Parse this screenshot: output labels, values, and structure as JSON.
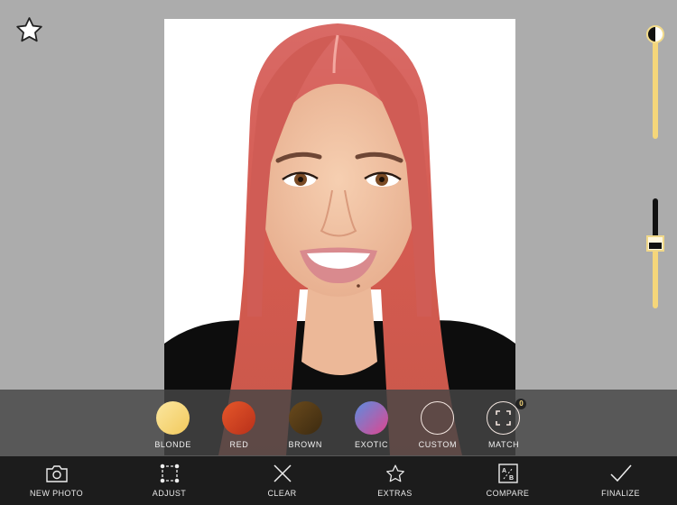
{
  "top": {
    "favorite_icon": "star-outline-icon"
  },
  "photo": {
    "description": "Portrait of smiling woman with hair recolored red",
    "hair_color": "#d9605c",
    "skin_color": "#f1c4a6",
    "shirt_color": "#0d0d0d"
  },
  "sliders": {
    "brightness": {
      "icon": "half-moon-contrast-icon",
      "value_fraction": 0.0
    },
    "intensity": {
      "value_fraction": 0.62
    }
  },
  "color_palette": {
    "swatches": [
      {
        "label": "BLONDE",
        "gradient": [
          "#fbe7a0",
          "#f2c95c"
        ]
      },
      {
        "label": "RED",
        "gradient": [
          "#e6572a",
          "#b8301a"
        ]
      },
      {
        "label": "BROWN",
        "gradient": [
          "#6a4a1c",
          "#3c2a10"
        ]
      },
      {
        "label": "EXOTIC",
        "gradient": [
          "#5b8ee0",
          "#e0458f"
        ]
      },
      {
        "label": "CUSTOM",
        "gradient": null
      },
      {
        "label": "MATCH",
        "gradient": null,
        "badge": "0"
      }
    ]
  },
  "toolbar": {
    "items": [
      {
        "label": "NEW PHOTO",
        "icon": "camera-icon"
      },
      {
        "label": "ADJUST",
        "icon": "adjust-points-icon"
      },
      {
        "label": "CLEAR",
        "icon": "x-icon"
      },
      {
        "label": "EXTRAS",
        "icon": "star-icon"
      },
      {
        "label": "COMPARE",
        "icon": "compare-ab-icon"
      },
      {
        "label": "FINALIZE",
        "icon": "checkmark-icon"
      }
    ]
  },
  "colors": {
    "background": "#acacac",
    "accent_yellow": "#f5d67a",
    "toolbar_bg": "#1c1c1c"
  }
}
